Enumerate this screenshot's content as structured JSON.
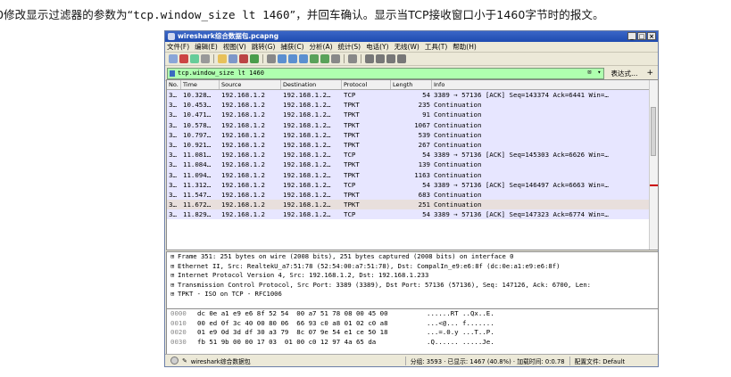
{
  "caption": {
    "prefix": "0修改显示过滤器的参数为“",
    "filter": "tcp.window_size lt 1460",
    "suffix": "”，并回车确认。显示当TCP接收窗口小于1460字节时的报文。"
  },
  "window": {
    "title": "wireshark综合数据包.pcapng",
    "buttons": [
      "_",
      "□",
      "×"
    ]
  },
  "menu": [
    "文件(F)",
    "编辑(E)",
    "视图(V)",
    "跳转(G)",
    "捕获(C)",
    "分析(A)",
    "统计(S)",
    "电话(Y)",
    "无线(W)",
    "工具(T)",
    "帮助(H)"
  ],
  "filter": {
    "value": "tcp.window_size lt 1460",
    "clear": "⊠",
    "expression_button": "表达式…",
    "plus_button": "+"
  },
  "columns": [
    "No.",
    "Time",
    "Source",
    "Destination",
    "Protocol",
    "Length",
    "Info"
  ],
  "packets": [
    [
      "3…",
      "10.328…",
      "192.168.1.2",
      "192.168.1.2…",
      "TCP",
      "54",
      "3389 → 57136 [ACK] Seq=143374 Ack=6441 Win=…"
    ],
    [
      "3…",
      "10.453…",
      "192.168.1.2",
      "192.168.1.2…",
      "TPKT",
      "235",
      "Continuation"
    ],
    [
      "3…",
      "10.471…",
      "192.168.1.2",
      "192.168.1.2…",
      "TPKT",
      "91",
      "Continuation"
    ],
    [
      "3…",
      "10.578…",
      "192.168.1.2",
      "192.168.1.2…",
      "TPKT",
      "1067",
      "Continuation"
    ],
    [
      "3…",
      "10.797…",
      "192.168.1.2",
      "192.168.1.2…",
      "TPKT",
      "539",
      "Continuation"
    ],
    [
      "3…",
      "10.921…",
      "192.168.1.2",
      "192.168.1.2…",
      "TPKT",
      "267",
      "Continuation"
    ],
    [
      "3…",
      "11.081…",
      "192.168.1.2",
      "192.168.1.2…",
      "TCP",
      "54",
      "3389 → 57136 [ACK] Seq=145303 Ack=6626 Win=…"
    ],
    [
      "3…",
      "11.084…",
      "192.168.1.2",
      "192.168.1.2…",
      "TPKT",
      "139",
      "Continuation"
    ],
    [
      "3…",
      "11.094…",
      "192.168.1.2",
      "192.168.1.2…",
      "TPKT",
      "1163",
      "Continuation"
    ],
    [
      "3…",
      "11.312…",
      "192.168.1.2",
      "192.168.1.2…",
      "TCP",
      "54",
      "3389 → 57136 [ACK] Seq=146497 Ack=6663 Win=…"
    ],
    [
      "3…",
      "11.547…",
      "192.168.1.2",
      "192.168.1.2…",
      "TPKT",
      "683",
      "Continuation"
    ],
    [
      "3…",
      "11.672…",
      "192.168.1.2",
      "192.168.1.2…",
      "TPKT",
      "251",
      "Continuation"
    ],
    [
      "3…",
      "11.829…",
      "192.168.1.2",
      "192.168.1.2…",
      "TCP",
      "54",
      "3389 → 57136 [ACK] Seq=147323 Ack=6774 Win=…"
    ]
  ],
  "selected_index": 11,
  "details": [
    "Frame 351: 251 bytes on wire (2008 bits), 251 bytes captured (2008 bits) on interface 0",
    "Ethernet II, Src: RealtekU_a7:51:78 (52:54:00:a7:51:78), Dst: CompalIn_e9:e6:8f (dc:0e:a1:e9:e6:8f)",
    "Internet Protocol Version 4, Src: 192.168.1.2, Dst: 192.168.1.233",
    "Transmission Control Protocol, Src Port: 3389 (3389), Dst Port: 57136 (57136), Seq: 147126, Ack: 6700, Len:",
    "TPKT - ISO on TCP - RFC1006"
  ],
  "bytes": [
    {
      "offset": "0000",
      "hex": "dc 0e a1 e9 e6 8f 52 54  00 a7 51 78 08 00 45 00",
      "ascii": "......RT ..Qx..E."
    },
    {
      "offset": "0010",
      "hex": "00 ed 0f 3c 40 00 80 06  66 93 c0 a8 01 02 c0 a8",
      "ascii": "...<@... f......."
    },
    {
      "offset": "0020",
      "hex": "01 e9 0d 3d df 30 a3 79  8c 07 9e 54 e1 ce 50 18",
      "ascii": "...=.0.y ...T..P."
    },
    {
      "offset": "0030",
      "hex": "fb 51 9b 00 00 17 03  01 00 c0 12 97 4a 65 da",
      "ascii": ".Q...... .....Je."
    }
  ],
  "status": {
    "file": "wireshark综合数据包",
    "packets": "分组: 3593 · 已显示: 1467 (40.8%) · 加载时间: 0:0.78",
    "profile": "配置文件: Default"
  }
}
